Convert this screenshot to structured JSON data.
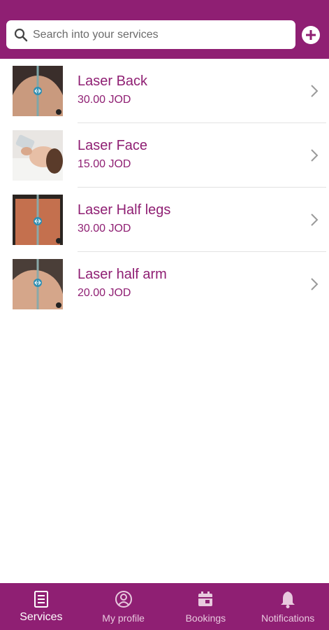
{
  "search": {
    "placeholder": "Search into your services"
  },
  "services": [
    {
      "name": "Laser Back",
      "price": "30.00 JOD"
    },
    {
      "name": "Laser Face",
      "price": "15.00 JOD"
    },
    {
      "name": "Laser Half legs",
      "price": "30.00 JOD"
    },
    {
      "name": "Laser half arm",
      "price": "20.00 JOD"
    }
  ],
  "nav": {
    "services": "Services",
    "profile": "My profile",
    "bookings": "Bookings",
    "notifications": "Notifications"
  },
  "colors": {
    "brand": "#8f1f73",
    "divider": "#e2e2e2",
    "nav_inactive": "#e8c9de"
  }
}
